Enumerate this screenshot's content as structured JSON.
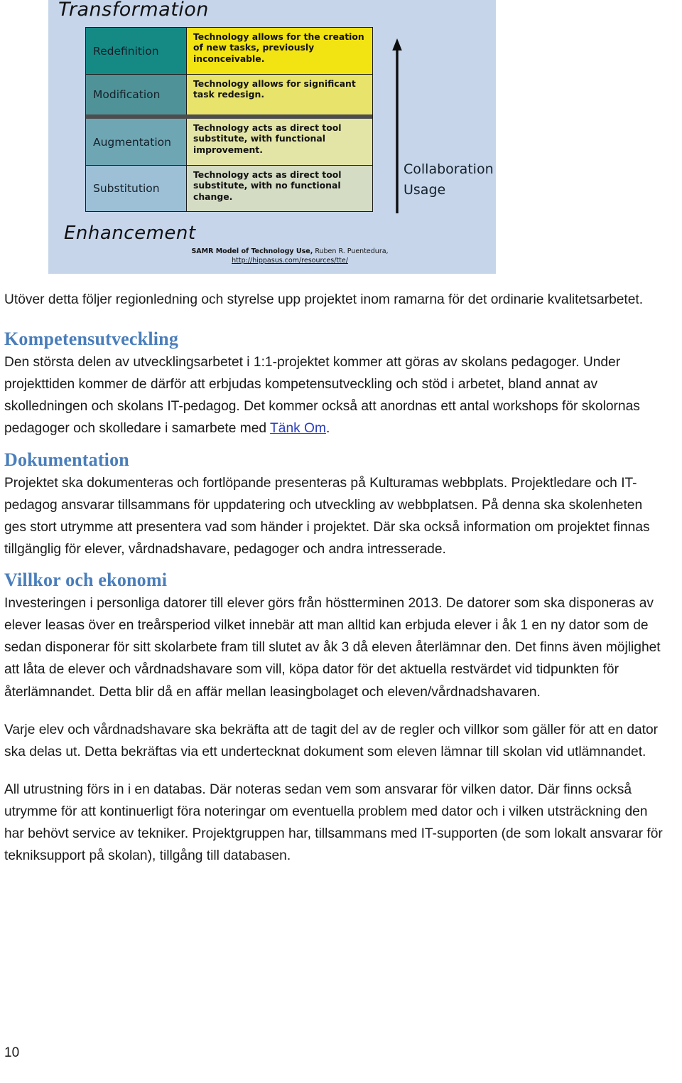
{
  "figure": {
    "name": "SAMR model diagram",
    "background_color": "#c6d5ea",
    "top_label": "Transformation",
    "bottom_label": "Enhancement",
    "side_labels": [
      "Collaboration",
      "Usage"
    ],
    "arrow": "upward-arrow",
    "rows": [
      {
        "level": "Redefinition",
        "description": "Technology allows for the creation of new tasks, previously inconceivable.",
        "level_color": "#158a85",
        "description_color": "#f2e313"
      },
      {
        "level": "Modification",
        "description": "Technology allows for significant task redesign.",
        "level_color": "#4f9398",
        "description_color": "#e8e36a"
      },
      {
        "level": "Augmentation",
        "description": "Technology acts as direct tool substitute, with functional improvement.",
        "level_color": "#6fa6b4",
        "description_color": "#e3e5a6"
      },
      {
        "level": "Substitution",
        "description": "Technology acts as direct tool substitute, with no functional change.",
        "level_color": "#9dc0d6",
        "description_color": "#d5dcc4"
      }
    ],
    "credit_title": "SAMR Model of Technology Use,",
    "credit_author": " Ruben R. Puentedura,",
    "credit_url": "http://hippasus.com/resources/tte/"
  },
  "document": {
    "intro_paragraph": "Utöver detta följer regionledning och styrelse upp projektet inom ramarna för det ordinarie kvalitetsarbetet.",
    "sections": [
      {
        "heading": "Kompetensutveckling",
        "paragraph_part1": "Den största delen av utvecklingsarbetet i 1:1-projektet kommer att göras av skolans pedagoger. Under projekttiden kommer de därför att erbjudas kompetensutveckling och stöd i arbetet, bland annat av skolledningen och skolans IT-pedagog. Det kommer också att anordnas ett antal workshops för skolornas pedagoger och skolledare i samarbete med ",
        "link_text": "Tänk Om",
        "paragraph_part2": "."
      },
      {
        "heading": "Dokumentation",
        "paragraph": "Projektet ska dokumenteras och fortlöpande presenteras på Kulturamas webbplats. Projektledare och IT-pedagog ansvarar tillsammans för uppdatering och utveckling av webbplatsen. På denna ska skolenheten ges stort utrymme att presentera vad som händer i projektet. Där ska också information om projektet finnas tillgänglig för elever, vårdnadshavare, pedagoger och andra intresserade."
      },
      {
        "heading": "Villkor och ekonomi",
        "paragraph1": "Investeringen i personliga datorer till elever görs från höstterminen 2013. De datorer som ska disponeras av elever leasas över en treårsperiod vilket innebär att man alltid kan erbjuda elever i åk 1 en ny dator som de sedan disponerar för sitt skolarbete fram till slutet av åk 3 då eleven återlämnar den. Det finns även möjlighet att låta de elever och vårdnadshavare som vill, köpa dator för det aktuella restvärdet vid tidpunkten för återlämnandet. Detta blir då en affär mellan leasingbolaget och eleven/vårdnadshavaren.",
        "paragraph2": "Varje elev och vårdnadshavare ska bekräfta att de tagit del av de regler och villkor som gäller för att en dator ska delas ut. Detta bekräftas via ett undertecknat dokument som eleven lämnar till skolan vid utlämnandet.",
        "paragraph3": "All utrustning förs in i en databas. Där noteras sedan vem som ansvarar för vilken dator. Där finns också utrymme för att kontinuerligt föra noteringar om eventuella problem med dator och i vilken utsträckning den har behövt service av tekniker. Projektgruppen har, tillsammans med IT-supporten (de som lokalt ansvarar för tekniksupport på skolan), tillgång till databasen."
      }
    ],
    "page_number": "10",
    "heading_color": "#4a7ebb",
    "link_color": "#2b3fbf"
  }
}
